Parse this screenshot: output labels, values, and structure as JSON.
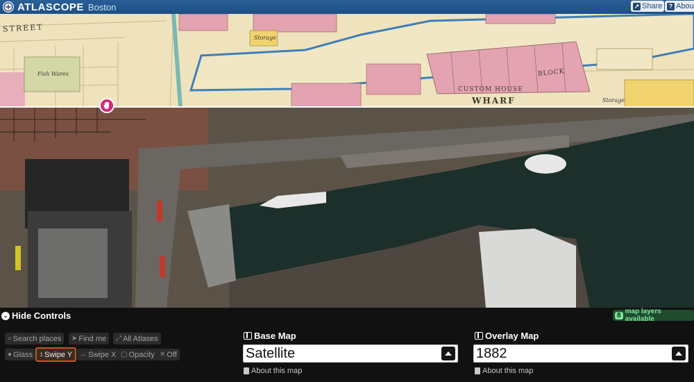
{
  "header": {
    "brand": "ATLASCOPE",
    "city": "Boston",
    "share_label": "Share",
    "about_label": "About"
  },
  "map": {
    "historic_labels": {
      "street": "STREET",
      "storage_top": "Storage",
      "fish_wares": "Fish Wares",
      "custom_house": "CUSTOM HOUSE",
      "block": "BLOCK",
      "wharf": "WHARF",
      "storage_right": "Storage"
    },
    "swipe_direction": "vertical",
    "swipe_fraction": 0.32
  },
  "controls": {
    "hide_label": "Hide Controls",
    "layers_count": "8",
    "layers_label": "map layers available",
    "tools": {
      "search_places": "Search places",
      "find_me": "Find me",
      "all_atlases": "All Atlases",
      "glass": "Glass",
      "swipe_y": "Swipe Y",
      "swipe_x": "Swipe X",
      "opacity": "Opacity",
      "off": "Off"
    },
    "active_tool": "swipe_y",
    "base_map": {
      "heading": "Base Map",
      "selected": "Satellite",
      "about": "About this map"
    },
    "overlay_map": {
      "heading": "Overlay Map",
      "selected": "1882",
      "about": "About this map"
    }
  },
  "colors": {
    "header_bg": "#1d4f86",
    "swipe_handle": "#d4287b",
    "active_tool_border": "#c8521e",
    "layers_badge": "#7be59a",
    "historic_pink": "#e9a5b2",
    "water": "#1c2f2a"
  }
}
